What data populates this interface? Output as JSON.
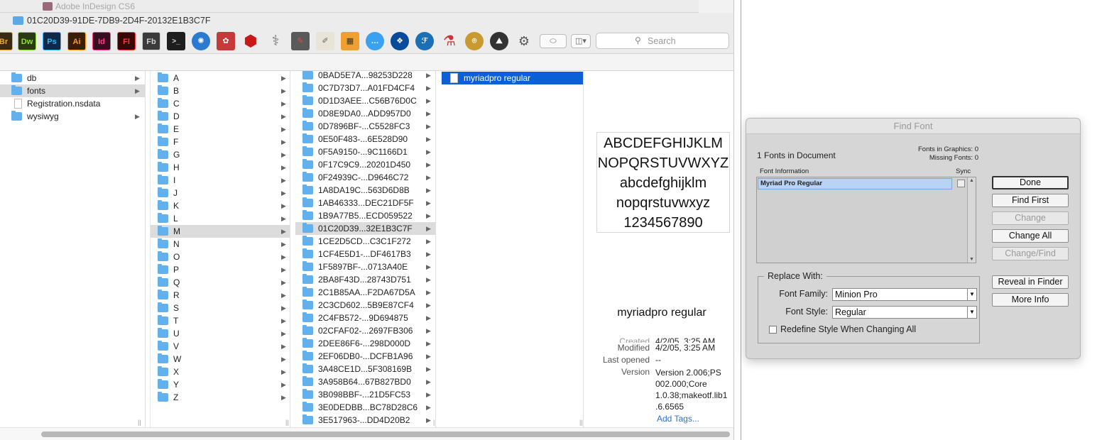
{
  "background_window": {
    "title": "Adobe InDesign CS6"
  },
  "finder": {
    "title": "01C20D39-91DE-7DB9-2D4F-20132E1B3C7F",
    "toolbar": {
      "apps": [
        {
          "name": "bridge-icon",
          "label": "Br",
          "color": "#3b2a12",
          "fg": "#e8a93c"
        },
        {
          "name": "dreamweaver-icon",
          "label": "Dw",
          "color": "#2a3a12",
          "fg": "#8fdd3a"
        },
        {
          "name": "photoshop-icon",
          "label": "Ps",
          "color": "#0f2a44",
          "fg": "#34b0ff"
        },
        {
          "name": "illustrator-icon",
          "label": "Ai",
          "color": "#3a1e07",
          "fg": "#ff9a1a"
        },
        {
          "name": "indesign-icon",
          "label": "Id",
          "color": "#3a0c22",
          "fg": "#ff3d8a"
        },
        {
          "name": "flash-icon",
          "label": "Fl",
          "color": "#3a0707",
          "fg": "#ff3a3a"
        },
        {
          "name": "flash-builder-icon",
          "label": "Fb",
          "color": "#3b3b3b",
          "fg": "#cfcfcf"
        }
      ],
      "search_placeholder": "Search"
    },
    "columns": {
      "col1": [
        {
          "label": "db",
          "type": "folder",
          "arrow": true
        },
        {
          "label": "fonts",
          "type": "folder",
          "arrow": true,
          "selected": true
        },
        {
          "label": "Registration.nsdata",
          "type": "file",
          "arrow": false
        },
        {
          "label": "wysiwyg",
          "type": "folder",
          "arrow": true
        }
      ],
      "col2": [
        "A",
        "B",
        "C",
        "D",
        "E",
        "F",
        "G",
        "H",
        "I",
        "J",
        "K",
        "L",
        "M",
        "N",
        "O",
        "P",
        "Q",
        "R",
        "S",
        "T",
        "U",
        "V",
        "W",
        "X",
        "Y",
        "Z"
      ],
      "col2_selected": "M",
      "col3": [
        "0BAD5E7A...98253D228",
        "0C7D73D7...A01FD4CF4",
        "0D1D3AEE...C56B76D0C",
        "0D8E9DA0...ADD957D0",
        "0D7896BF-...C5528FC3",
        "0E50F483-...6E528D90",
        "0F5A9150-...9C1166D1",
        "0F17C9C9...20201D450",
        "0F24939C-...D9646C72",
        "1A8DA19C...563D6D8B",
        "1AB46333...DEC21DF5F",
        "1B9A77B5...ECD059522",
        "01C20D39...32E1B3C7F",
        "1CE2D5CD...C3C1F272",
        "1CF4E5D1-...DF4617B3",
        "1F5897BF-...0713A40E",
        "2BA8F43D...28743D751",
        "2C1B85AA...F2DA67D5A",
        "2C3CD602...5B9E87CF4",
        "2C4FB572-...9D694875",
        "02CFAF02-...2697FB306",
        "2DEE86F6-...298D000D",
        "2EF06DB0-...DCFB1A96",
        "3A48CE1D...5F308169B",
        "3A958B64...67B827BD0",
        "3B098BBF-...21D5FC53",
        "3E0DEDBB...BC78D28C6",
        "3E517963-...DD4D20B2"
      ],
      "col3_selected": "01C20D39...32E1B3C7F",
      "col4": [
        {
          "label": "myriadpro regular",
          "selected": true
        }
      ]
    },
    "preview": {
      "sample_lines": [
        "ABCDEFGHIJKLM",
        "NOPQRSTUVWXYZ",
        "abcdefghijklm",
        "nopqrstuvwxyz",
        "1234567890"
      ],
      "name": "myriadpro regular",
      "created_label": "Created",
      "created_value": "4/2/05, 3:25 AM",
      "modified_label": "Modified",
      "modified_value": "4/2/05, 3:25 AM",
      "opened_label": "Last opened",
      "opened_value": "--",
      "version_label": "Version",
      "version_lines": [
        "Version 2.006;PS",
        "002.000;Core",
        "1.0.38;makeotf.lib1",
        ".6.6565"
      ],
      "add_tags": "Add Tags..."
    }
  },
  "find_font": {
    "title": "Find Font",
    "fonts_in_document": "1 Fonts in Document",
    "fonts_in_graphics": "Fonts in Graphics: 0",
    "missing_fonts": "Missing Fonts: 0",
    "font_information_label": "Font Information",
    "sync_label": "Sync",
    "font_item": "Myriad Pro Regular",
    "buttons": {
      "done": "Done",
      "find_first": "Find First",
      "change": "Change",
      "change_all": "Change All",
      "change_find": "Change/Find",
      "reveal": "Reveal in Finder",
      "more_info": "More Info"
    },
    "replace_with_label": "Replace With:",
    "font_family_label": "Font Family:",
    "font_family_value": "Minion Pro",
    "font_style_label": "Font Style:",
    "font_style_value": "Regular",
    "redefine_label": "Redefine Style When Changing All"
  }
}
